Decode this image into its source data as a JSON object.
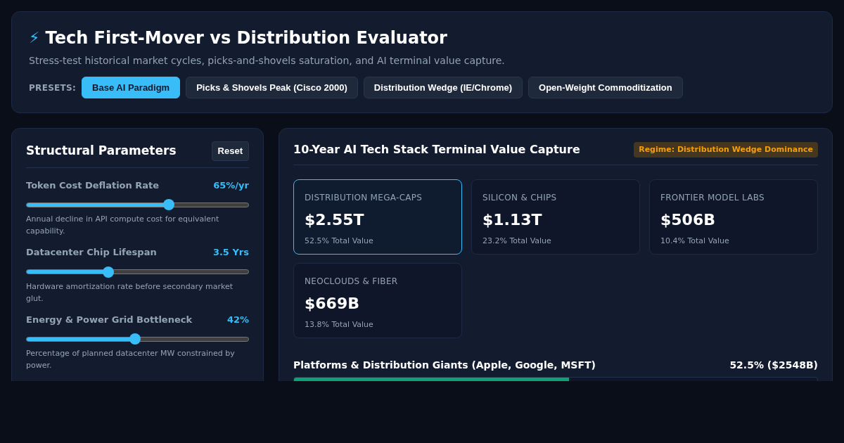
{
  "header": {
    "icon": "⚡",
    "title": "Tech First-Mover vs Distribution Evaluator",
    "subtitle": "Stress-test historical market cycles, picks-and-shovels saturation, and AI terminal value capture.",
    "presets_label": "PRESETS:",
    "presets": [
      {
        "label": "Base AI Paradigm",
        "selected": true
      },
      {
        "label": "Picks & Shovels Peak (Cisco 2000)",
        "selected": false
      },
      {
        "label": "Distribution Wedge (IE/Chrome)",
        "selected": false
      },
      {
        "label": "Open-Weight Commoditization",
        "selected": false
      }
    ]
  },
  "parameters": {
    "title": "Structural Parameters",
    "reset": "Reset",
    "sliders": [
      {
        "label": "Token Cost Deflation Rate",
        "reading": "65%/yr",
        "level": 0.64,
        "description": "Annual decline in API compute cost for equivalent capability."
      },
      {
        "label": "Datacenter Chip Lifespan",
        "reading": "3.5 Yrs",
        "level": 0.37,
        "description": "Hardware amortization rate before secondary market glut."
      },
      {
        "label": "Energy & Power Grid Bottleneck",
        "reading": "42%",
        "level": 0.49,
        "description": "Percentage of planned datacenter MW constrained by power."
      }
    ]
  },
  "capture": {
    "title": "10-Year AI Tech Stack Terminal Value Capture",
    "regime": "Regime: Distribution Wedge Dominance",
    "cards": [
      {
        "label": "DISTRIBUTION MEGA-CAPS",
        "value": "$2.55T",
        "share": "52.5% Total Value",
        "selected": true
      },
      {
        "label": "SILICON & CHIPS",
        "value": "$1.13T",
        "share": "23.2% Total Value",
        "selected": false
      },
      {
        "label": "FRONTIER MODEL LABS",
        "value": "$506B",
        "share": "10.4% Total Value",
        "selected": false
      },
      {
        "label": "NEOCLOUDS & FIBER",
        "value": "$669B",
        "share": "13.8% Total Value",
        "selected": false
      }
    ],
    "segments": [
      {
        "label": "Platforms & Distribution Giants (Apple, Google, MSFT)",
        "reading": "52.5% ($2548B)",
        "level": 0.525
      }
    ]
  }
}
